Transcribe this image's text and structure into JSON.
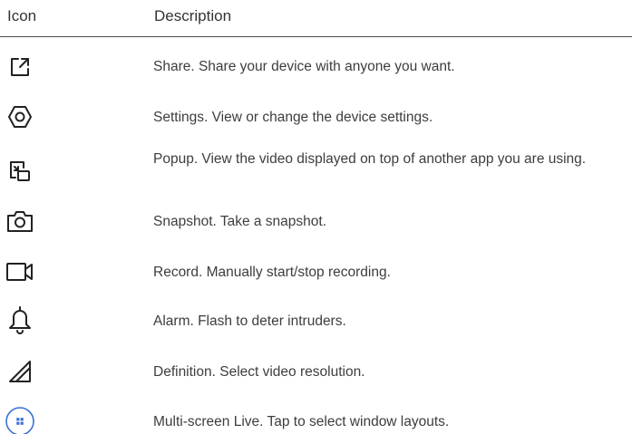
{
  "header": {
    "icon_label": "Icon",
    "description_label": "Description"
  },
  "rows": [
    {
      "icon": "share-icon",
      "text": "Share. Share your device with anyone you want."
    },
    {
      "icon": "settings-hexagon-icon",
      "text": "Settings. View or change the device settings."
    },
    {
      "icon": "popup-icon",
      "text": "Popup. View the video displayed on top of another app you are using."
    },
    {
      "icon": "camera-icon",
      "text": "Snapshot. Take a snapshot."
    },
    {
      "icon": "video-camera-icon",
      "text": "Record. Manually start/stop recording."
    },
    {
      "icon": "bell-icon",
      "text": "Alarm. Flash to deter intruders."
    },
    {
      "icon": "signal-triangle-icon",
      "text": "Definition. Select video resolution."
    },
    {
      "icon": "grid-circle-icon",
      "text": "Multi-screen Live. Tap to select window layouts."
    }
  ],
  "colors": {
    "icon_stroke": "#222222",
    "accent_blue": "#3b6fd8",
    "divider": "#4a4a4a"
  }
}
